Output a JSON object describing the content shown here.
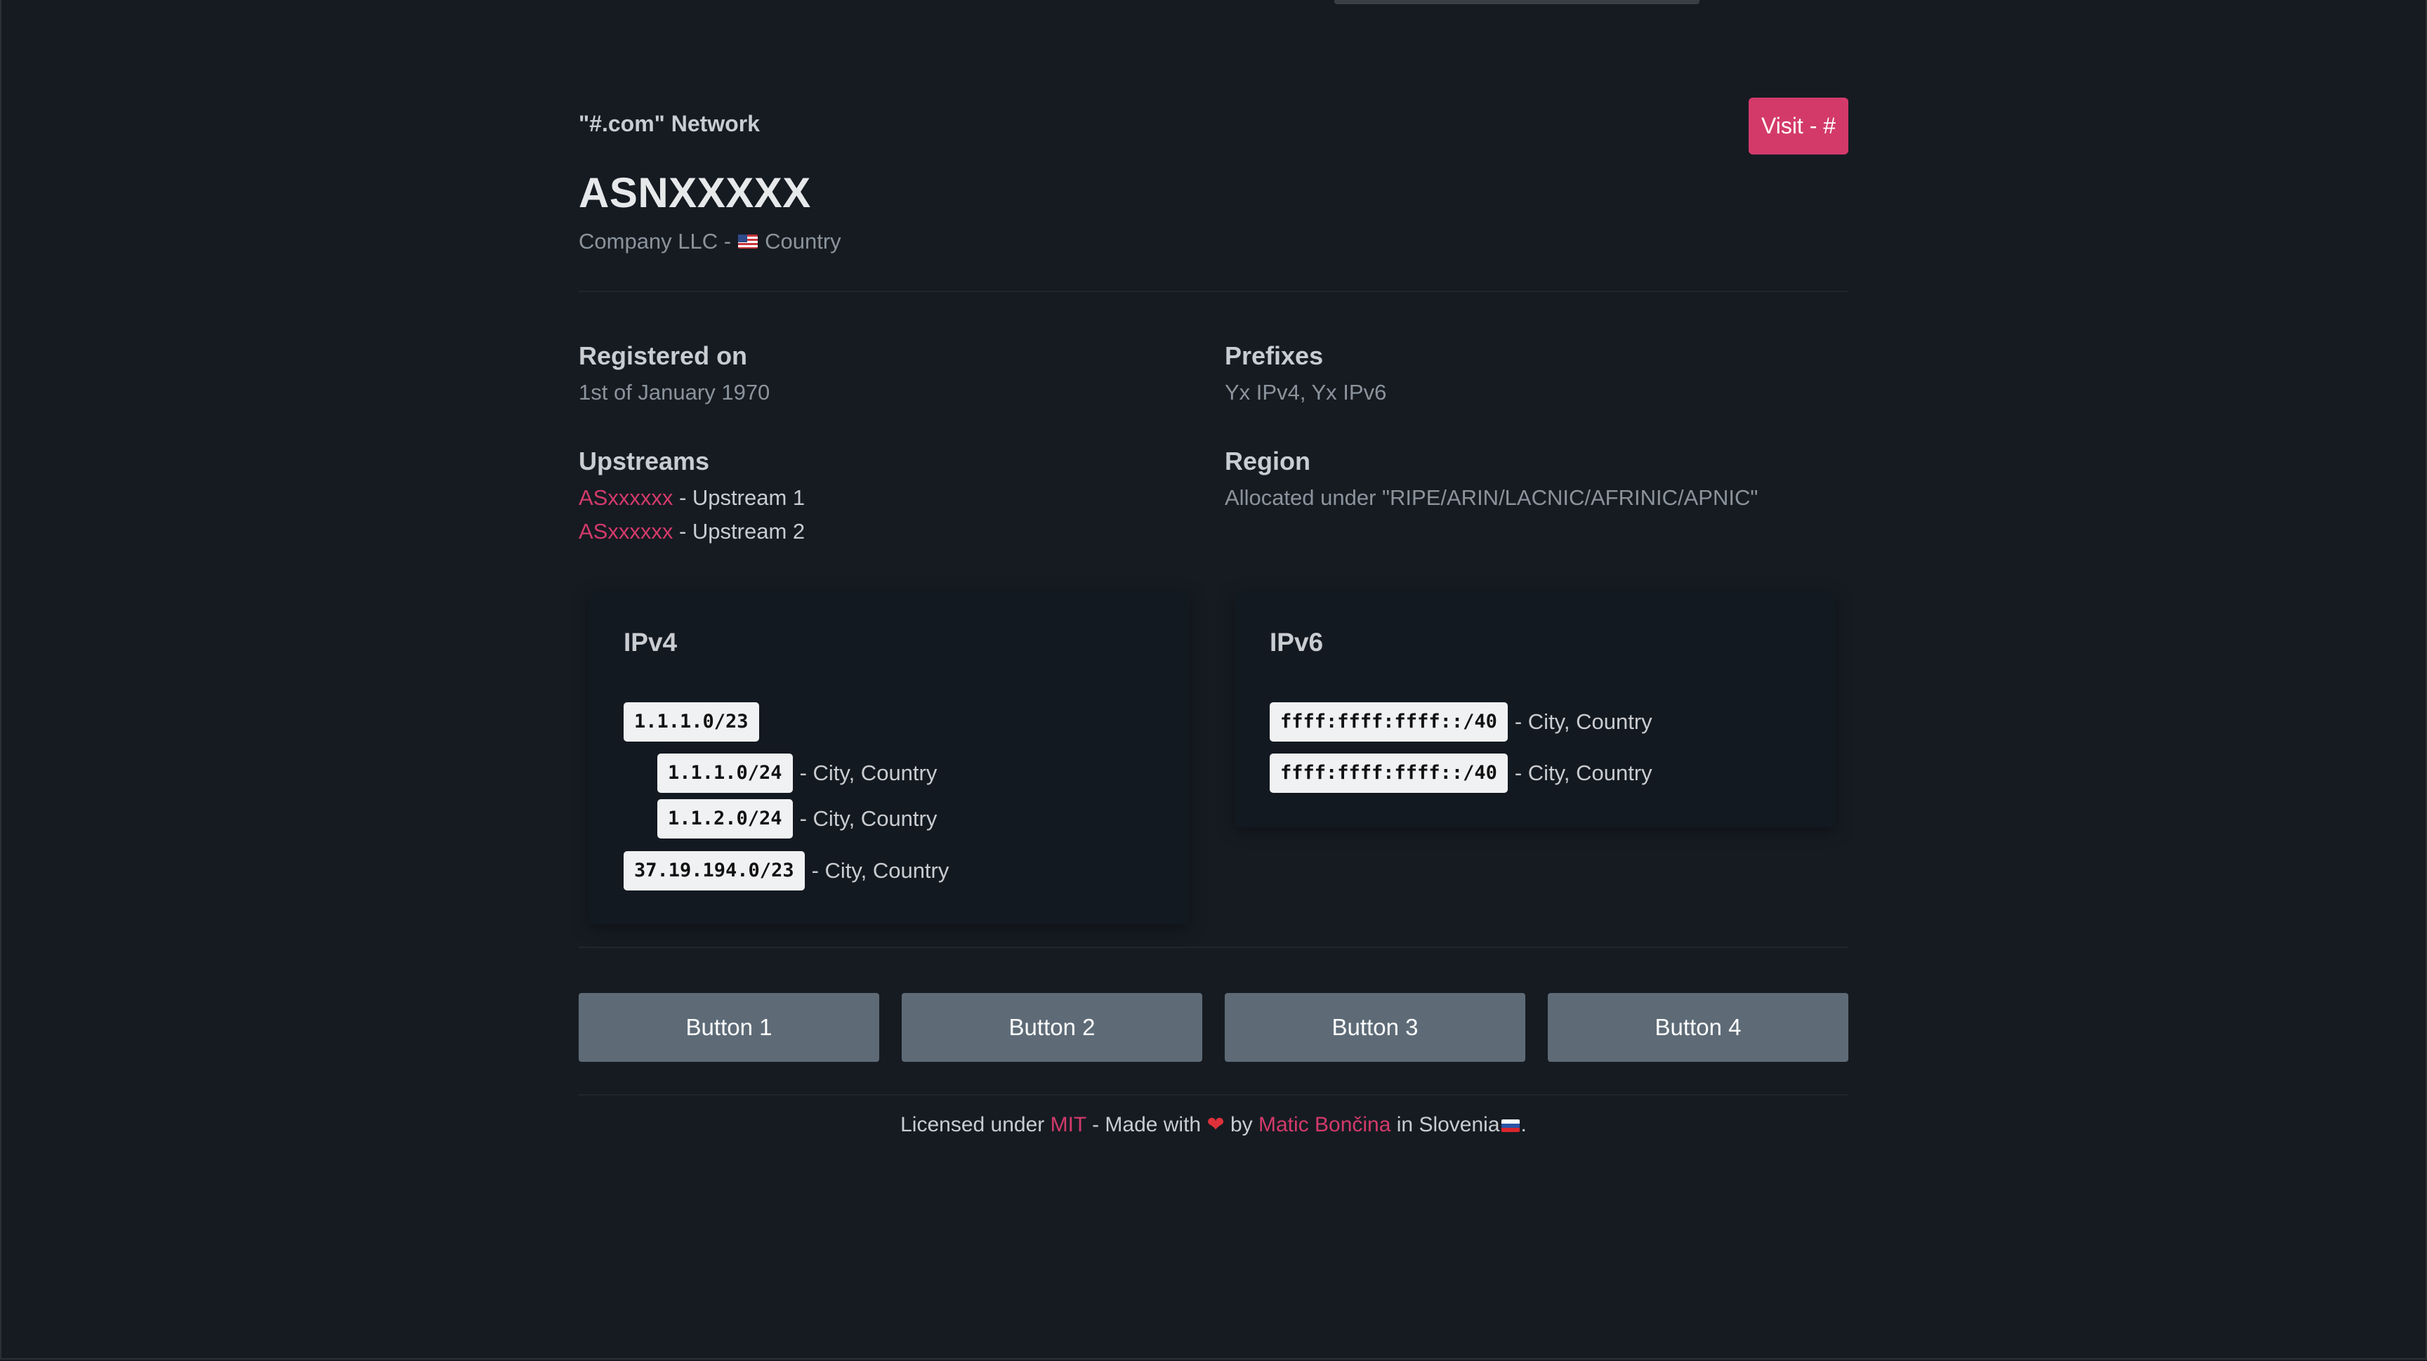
{
  "header": {
    "network_label": "\"#.com\" Network",
    "visit_button": "Visit - #",
    "asn": "ASNXXXXX",
    "company": "Company LLC -",
    "country": "Country"
  },
  "info": {
    "registered_label": "Registered on",
    "registered_value": "1st of January 1970",
    "prefixes_label": "Prefixes",
    "prefixes_value": "Yx IPv4, Yx IPv6",
    "upstreams_label": "Upstreams",
    "upstreams": [
      {
        "asn": "ASxxxxxx",
        "name": "- Upstream 1"
      },
      {
        "asn": "ASxxxxxx",
        "name": "- Upstream 2"
      }
    ],
    "region_label": "Region",
    "region_value": "Allocated under \"RIPE/ARIN/LACNIC/AFRINIC/APNIC\""
  },
  "ipv4": {
    "title": "IPv4",
    "prefixes": [
      {
        "prefix": "1.1.1.0/23",
        "location": ""
      },
      {
        "prefix": "1.1.1.0/24",
        "location": "- City, Country"
      },
      {
        "prefix": "1.1.2.0/24",
        "location": "- City, Country"
      },
      {
        "prefix": "37.19.194.0/23",
        "location": "- City, Country"
      }
    ]
  },
  "ipv6": {
    "title": "IPv6",
    "prefixes": [
      {
        "prefix": "ffff:ffff:ffff::/40",
        "location": "- City, Country"
      },
      {
        "prefix": "ffff:ffff:ffff::/40",
        "location": "- City, Country"
      }
    ]
  },
  "buttons": [
    "Button 1",
    "Button 2",
    "Button 3",
    "Button 4"
  ],
  "footer": {
    "licensed": "Licensed under",
    "mit": "MIT",
    "made_with": "- Made with",
    "heart": "❤",
    "by": "by",
    "author": "Matic Bončina",
    "in": "in Slovenia",
    "end": "."
  }
}
